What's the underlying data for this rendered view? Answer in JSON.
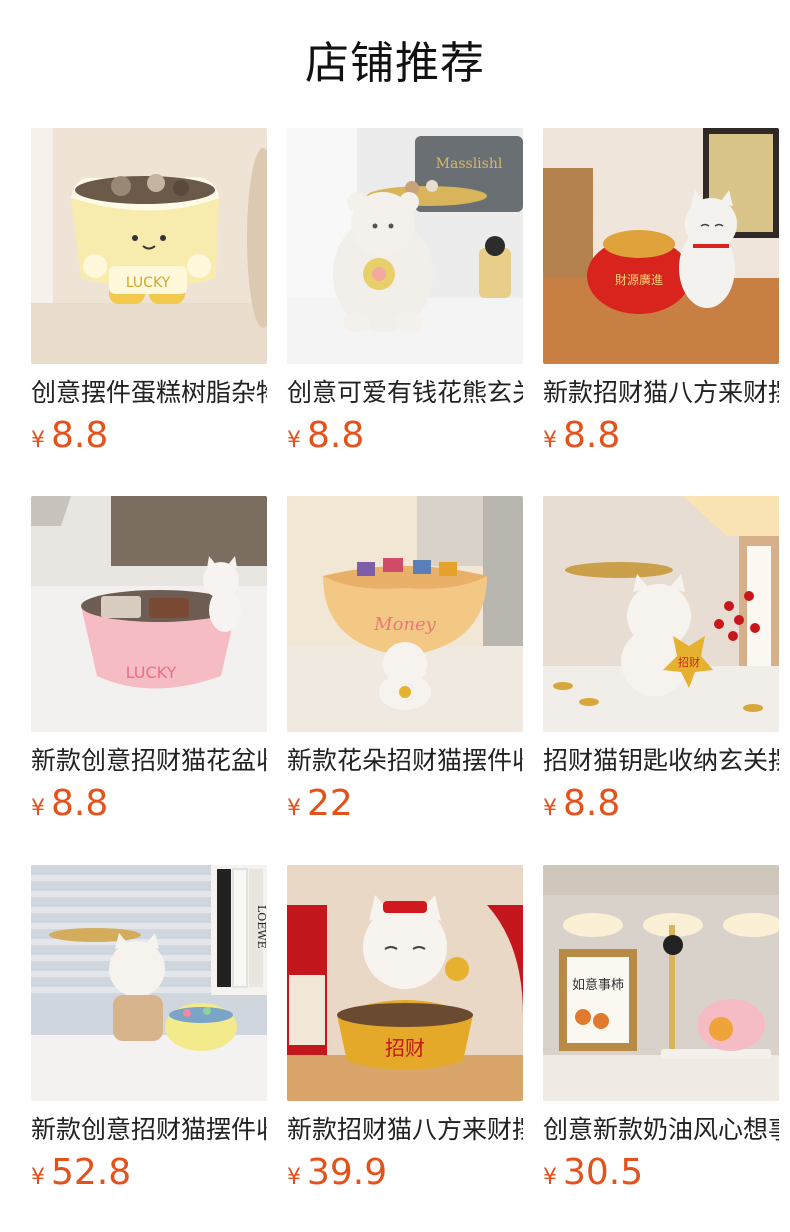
{
  "section": {
    "title": "店铺推荐"
  },
  "products": [
    {
      "name": "创意摆件蛋糕树脂杂物收纳",
      "currency": "¥",
      "price": "8.8",
      "image": "cake-bowl-lucky",
      "image_text": "LUCKY"
    },
    {
      "name": "创意可爱有钱花熊玄关托盘",
      "currency": "¥",
      "price": "8.8",
      "image": "bear-tray",
      "image_text": "Masslishl"
    },
    {
      "name": "新款招财猫八方来财摆件",
      "currency": "¥",
      "price": "8.8",
      "image": "cat-red-bag",
      "image_text": ""
    },
    {
      "name": "新款创意招财猫花盆收纳",
      "currency": "¥",
      "price": "8.8",
      "image": "pink-bowl-cat",
      "image_text": "LUCKY"
    },
    {
      "name": "新款花朵招财猫摆件收纳",
      "currency": "¥",
      "price": "22",
      "image": "money-bowl-cat",
      "image_text": "Money"
    },
    {
      "name": "招财猫钥匙收纳玄关摆件",
      "currency": "¥",
      "price": "8.8",
      "image": "cat-tray-star",
      "image_text": "招财"
    },
    {
      "name": "新款创意招财猫摆件收纳",
      "currency": "¥",
      "price": "52.8",
      "image": "cat-tray-overalls",
      "image_text": "LOEWE"
    },
    {
      "name": "新款招财猫八方来财摆件",
      "currency": "¥",
      "price": "39.9",
      "image": "cat-gold-ingot",
      "image_text": "招财"
    },
    {
      "name": "创意新款奶油风心想事成摆件",
      "currency": "¥",
      "price": "30.5",
      "image": "frame-pink-bowl",
      "image_text": "如意事柿"
    }
  ],
  "colors": {
    "price": "#e4521b",
    "title": "#111111",
    "name": "#222222"
  }
}
